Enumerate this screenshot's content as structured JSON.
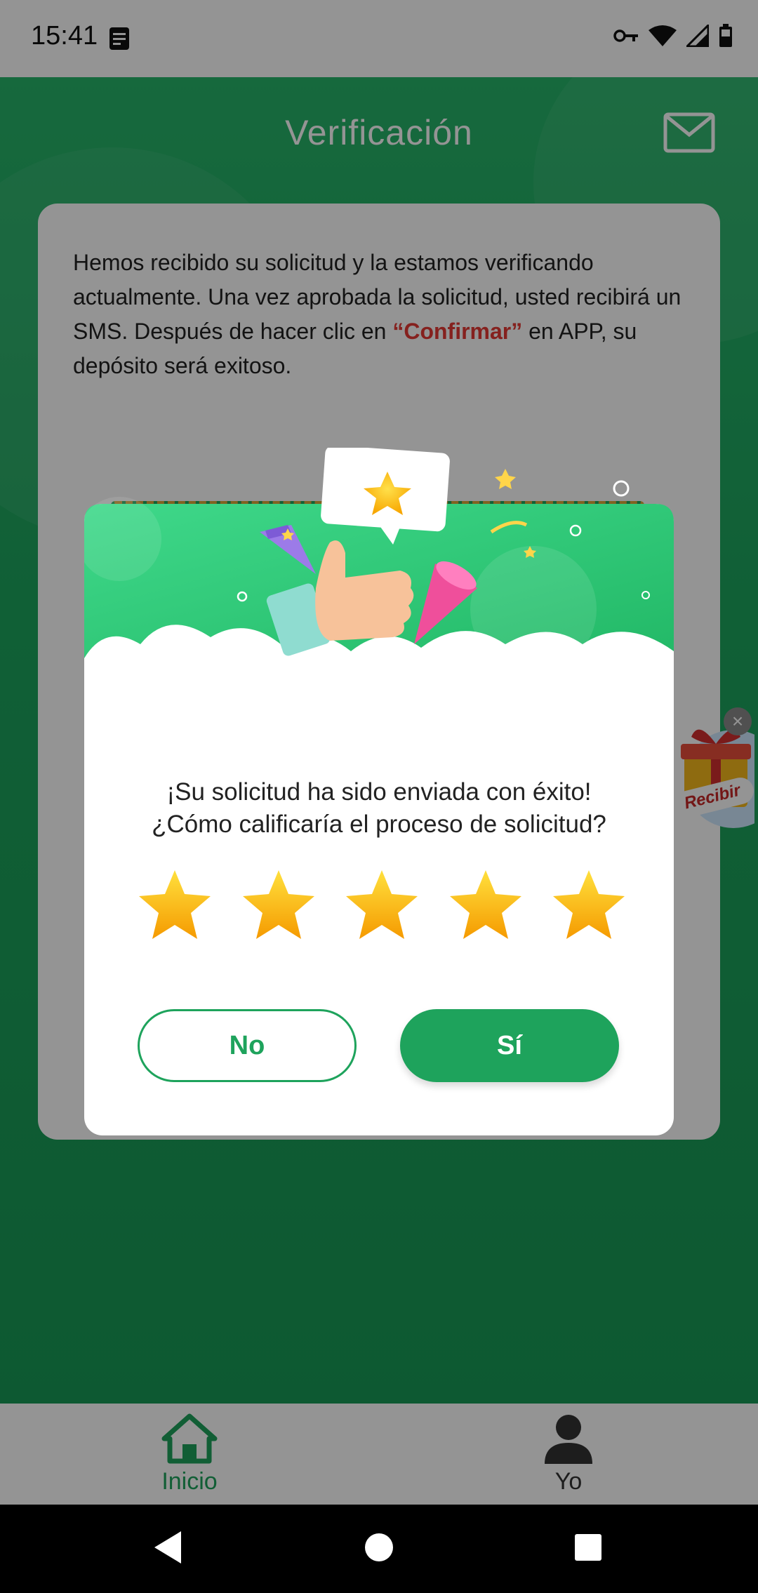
{
  "status_bar": {
    "time": "15:41"
  },
  "header": {
    "title": "Verificación",
    "mail_icon": "mail-icon"
  },
  "info_card": {
    "text_before": "Hemos recibido su solicitud y la estamos verificando actualmente. Una vez aprobada la solicitud, usted recibirá un SMS. Después de hacer clic en ",
    "highlight": "“Confirmar”",
    "text_after": " en APP, su depósito será exitoso.",
    "highlight_color": "#e53935"
  },
  "floating_gift": {
    "label": "Recibir",
    "close": "×"
  },
  "dialog": {
    "line1": "¡Su solicitud ha sido enviada con éxito!",
    "line2": "¿Cómo calificaría el proceso de solicitud?",
    "rating": 5,
    "rating_max": 5,
    "no_label": "No",
    "yes_label": "Sí"
  },
  "tab_bar": {
    "home_label": "Inicio",
    "me_label": "Yo"
  },
  "colors": {
    "brand_green": "#1ea35c",
    "star_gold": "#fbbf0b"
  }
}
